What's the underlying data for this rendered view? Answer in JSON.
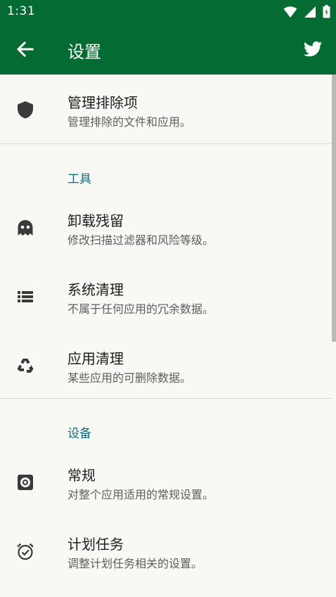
{
  "status": {
    "time": "1:31",
    "icons": [
      "wifi-icon",
      "signal-icon",
      "battery-icon"
    ]
  },
  "appbar": {
    "title": "设置",
    "back_icon": "arrow-left-icon",
    "action_icon": "twitter-icon"
  },
  "colors": {
    "primary": "#046b33",
    "section_header": "#0e6c82",
    "background": "#f8f9f5"
  },
  "items": {
    "exclusions": {
      "title": "管理排除项",
      "subtitle": "管理排除的文件和应用。",
      "icon": "shield-icon"
    },
    "corpse": {
      "title": "卸载残留",
      "subtitle": "修改扫描过滤器和风险等级。",
      "icon": "ghost-icon"
    },
    "system": {
      "title": "系统清理",
      "subtitle": "不属于任何应用的冗余数据。",
      "icon": "list-icon"
    },
    "app": {
      "title": "应用清理",
      "subtitle": "某些应用的可删除数据。",
      "icon": "recycle-icon"
    },
    "general": {
      "title": "常规",
      "subtitle": "对整个应用适用的常规设置。",
      "icon": "gear-icon"
    },
    "scheduler": {
      "title": "计划任务",
      "subtitle": "调整计划任务相关的设置。",
      "icon": "alarm-clock-icon"
    }
  },
  "sections": {
    "tools": "工具",
    "device": "设备"
  }
}
